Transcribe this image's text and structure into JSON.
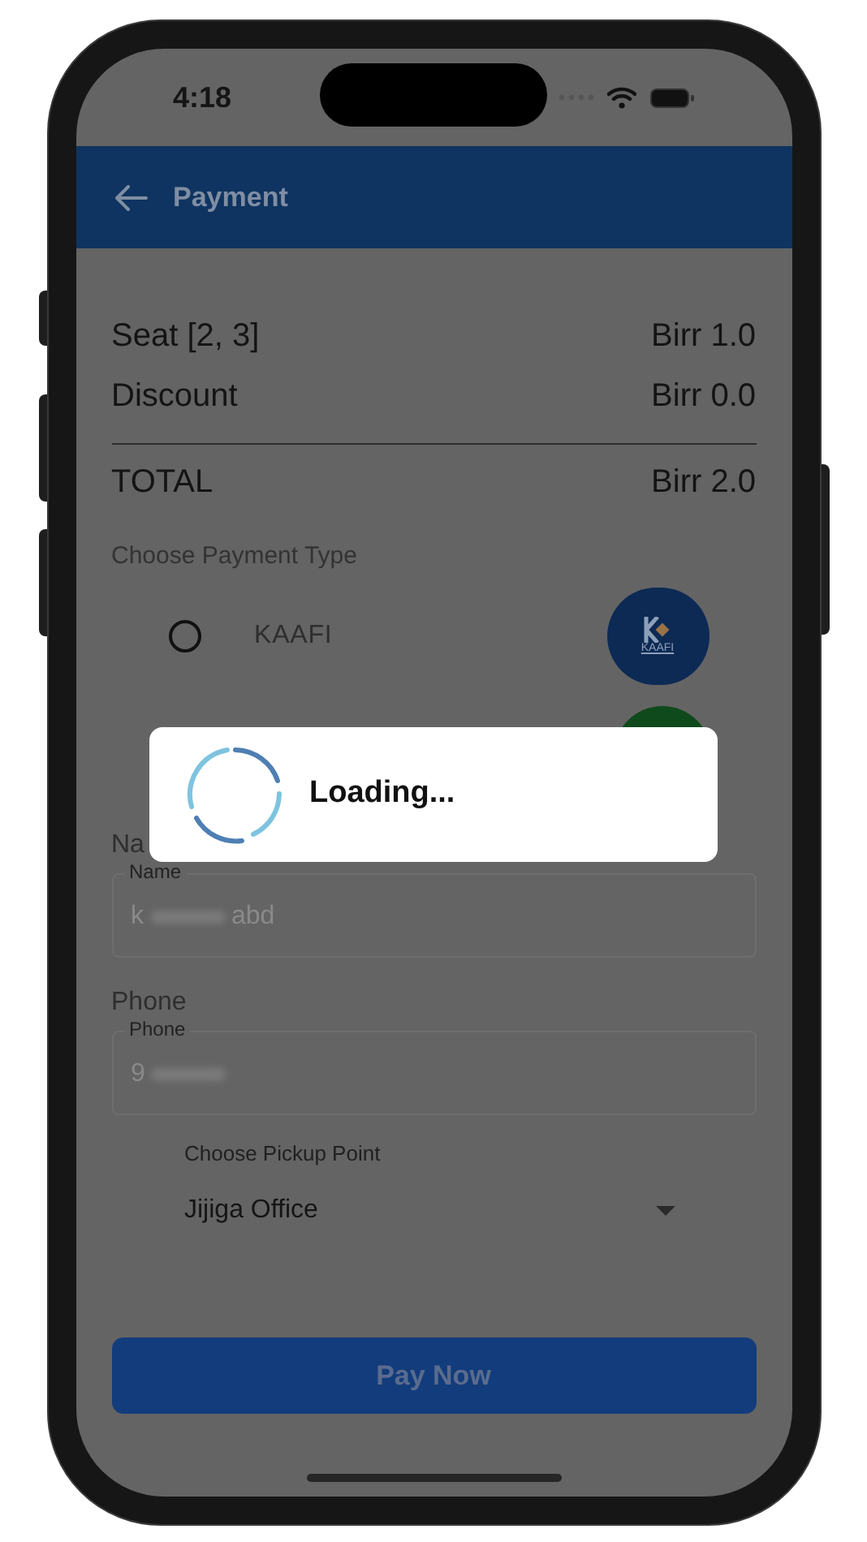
{
  "status_bar": {
    "time": "4:18"
  },
  "app_bar": {
    "title": "Payment"
  },
  "summary": [
    {
      "label": "Seat [2, 3]",
      "value": "Birr 1.0"
    },
    {
      "label": "Discount",
      "value": "Birr 0.0"
    }
  ],
  "total": {
    "label": "TOTAL",
    "value": "Birr 2.0"
  },
  "payment": {
    "title": "Choose Payment Type",
    "options": [
      {
        "label": "KAAFI",
        "selected": false,
        "logo_text": "KAAFI"
      }
    ]
  },
  "name": {
    "label": "Na",
    "field_label": "Name",
    "value": "k",
    "value_tail": "abd"
  },
  "phone": {
    "label": "Phone",
    "field_label": "Phone",
    "value": "9"
  },
  "pickup": {
    "label": "Choose Pickup Point",
    "value": "Jijiga Office"
  },
  "pay_button": "Pay Now",
  "dialog": {
    "text": "Loading..."
  }
}
